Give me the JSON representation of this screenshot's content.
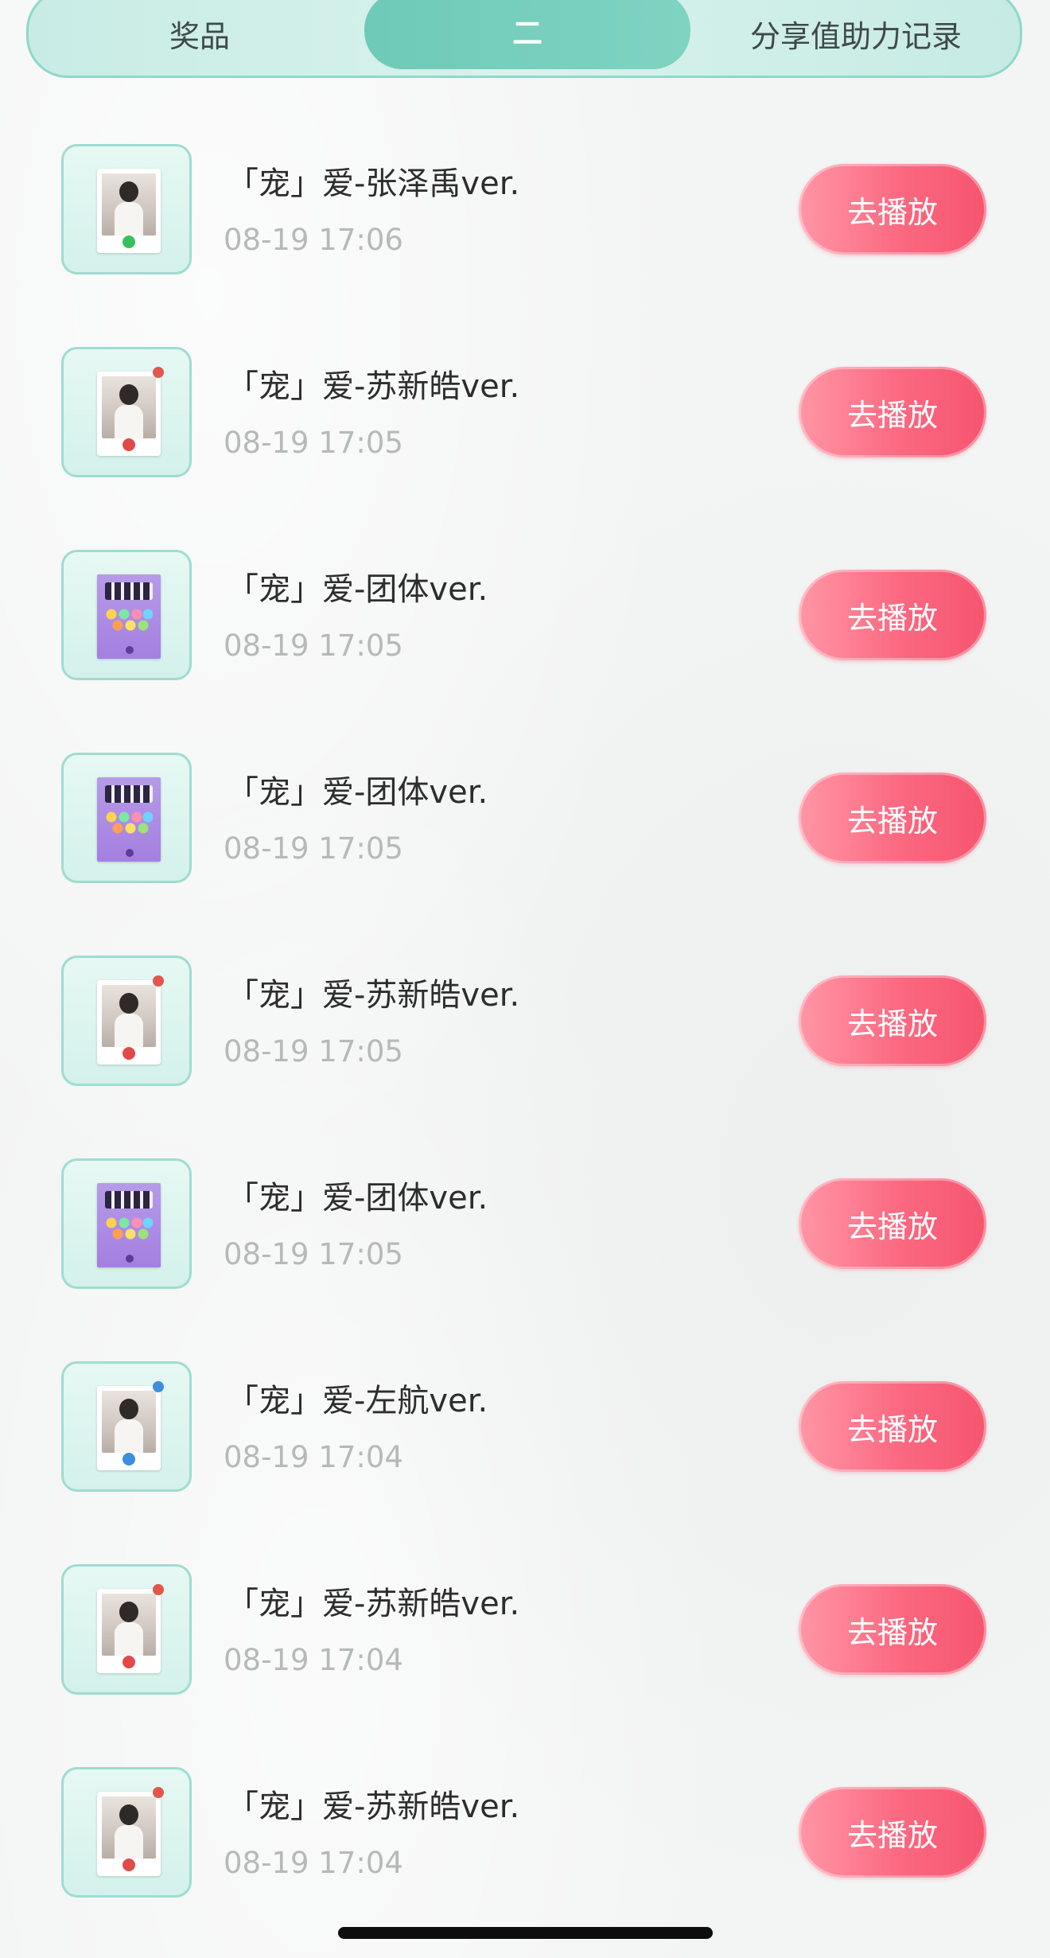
{
  "tabs": [
    {
      "label": "奖品",
      "active": false
    },
    {
      "label": "二",
      "active": true
    },
    {
      "label": "分享值助力记录",
      "active": false
    }
  ],
  "colors": {
    "accent_teal": "#7fd3c1",
    "play_button": "#fb6880",
    "title_text": "#2d2d2d",
    "time_text": "#b6b9b9"
  },
  "records": [
    {
      "title": "「宠」爱-张泽禹ver.",
      "time": "08-19 17:06",
      "button": "去播放",
      "thumbnail": "member-card"
    },
    {
      "title": "「宠」爱-苏新皓ver.",
      "time": "08-19 17:05",
      "button": "去播放",
      "thumbnail": "member-card"
    },
    {
      "title": "「宠」爱-团体ver.",
      "time": "08-19 17:05",
      "button": "去播放",
      "thumbnail": "group-card"
    },
    {
      "title": "「宠」爱-团体ver.",
      "time": "08-19 17:05",
      "button": "去播放",
      "thumbnail": "group-card"
    },
    {
      "title": "「宠」爱-苏新皓ver.",
      "time": "08-19 17:05",
      "button": "去播放",
      "thumbnail": "member-card"
    },
    {
      "title": "「宠」爱-团体ver.",
      "time": "08-19 17:05",
      "button": "去播放",
      "thumbnail": "group-card"
    },
    {
      "title": "「宠」爱-左航ver.",
      "time": "08-19 17:04",
      "button": "去播放",
      "thumbnail": "member-card"
    },
    {
      "title": "「宠」爱-苏新皓ver.",
      "time": "08-19 17:04",
      "button": "去播放",
      "thumbnail": "member-card"
    },
    {
      "title": "「宠」爱-苏新皓ver.",
      "time": "08-19 17:04",
      "button": "去播放",
      "thumbnail": "member-card"
    }
  ]
}
